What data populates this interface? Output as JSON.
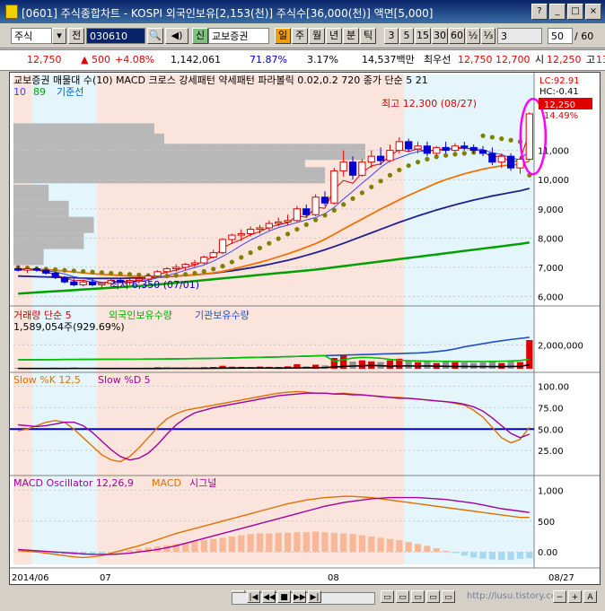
{
  "window": {
    "title": "[0601] 주식종합차트 - KOSPI 외국인보유[2,153(천)] 주식수[36,000(천)] 액면[5,000]",
    "buttons": [
      "?",
      "_",
      "□",
      "×"
    ]
  },
  "toolbar": {
    "market": "주식",
    "market_suffix": "전",
    "code": "030610",
    "name_tag": "신",
    "company": "교보증권",
    "period_buttons": [
      "일",
      "주",
      "월",
      "년",
      "분",
      "틱"
    ],
    "interval_buttons": [
      "3",
      "5",
      "15",
      "30",
      "60",
      "½",
      "⅓",
      "3"
    ],
    "count": "50",
    "count_suffix": "/ 60"
  },
  "quote": {
    "price": "12,750",
    "change": "500",
    "change_pct": "+4.08%",
    "volume": "1,142,061",
    "ratio1": "71.87%",
    "ratio2": "3.17%",
    "amount": "14,537백만",
    "best_label": "최우선",
    "best_ask": "12,750",
    "best_bid": "12,700",
    "open_label": "시",
    "open": "12,250",
    "high_label": "고",
    "high": "13"
  },
  "colors": {
    "up": "#e00000",
    "down": "#0000d0",
    "sar": "#808000",
    "ma5": "#e00000",
    "ma10": "#4040ff",
    "ma20": "#f07000",
    "ma60": "#202090",
    "ma120": "#00a000",
    "volume_profile": "#b8b8b8",
    "bg_salmon": "#fbe4dc",
    "bg_cyan": "#e4f6fc",
    "highlight": "#ff00ff"
  },
  "panels": {
    "price": {
      "legend_line1": "교보증권 매물대 수(10) MACD 크로스 강세패턴 약세패턴 파라볼릭 0.02,0.2 720 종가 단순 5 21",
      "legend_line2_a": "10",
      "legend_line2_b": "89",
      "legend_line2_c": "기준선",
      "axis_info": [
        "LC:92.91",
        "HC:-0.41"
      ],
      "current_price_tag": "12,250",
      "current_pct_tag": "14.49%",
      "high_annotation": "최고 12,300 (08/27)",
      "low_annotation": "최저 6,350 (07/01)"
    },
    "volume": {
      "legend": "거래량 단순 5",
      "legend_b": "외국인보유수량",
      "legend_c": "기관보유수량",
      "value_line": "1,589,054주(929.69%)"
    },
    "stochastic": {
      "legend_a": "Slow %K 12,5",
      "legend_b": "Slow %D 5"
    },
    "macd": {
      "legend_a": "MACD Oscillator 12,26,9",
      "legend_b": "MACD",
      "legend_c": "시그널"
    },
    "xaxis": {
      "labels": [
        "2014/06",
        "07",
        "08",
        "08/27"
      ]
    }
  },
  "chart_data": [
    {
      "type": "candlestick",
      "title": "교보증권",
      "ylim": [
        5800,
        12800
      ],
      "yticks": [
        6000,
        7000,
        8000,
        9000,
        10000,
        11000
      ],
      "candles": [
        {
          "o": 6950,
          "h": 7050,
          "l": 6850,
          "c": 6900
        },
        {
          "o": 6900,
          "h": 7000,
          "l": 6800,
          "c": 6950
        },
        {
          "o": 6950,
          "h": 7000,
          "l": 6850,
          "c": 6900
        },
        {
          "o": 6900,
          "h": 6950,
          "l": 6750,
          "c": 6800
        },
        {
          "o": 6800,
          "h": 6850,
          "l": 6600,
          "c": 6650
        },
        {
          "o": 6650,
          "h": 6700,
          "l": 6450,
          "c": 6500
        },
        {
          "o": 6500,
          "h": 6600,
          "l": 6350,
          "c": 6400
        },
        {
          "o": 6400,
          "h": 6550,
          "l": 6350,
          "c": 6500
        },
        {
          "o": 6500,
          "h": 6600,
          "l": 6350,
          "c": 6400
        },
        {
          "o": 6400,
          "h": 6500,
          "l": 6300,
          "c": 6450
        },
        {
          "o": 6450,
          "h": 6600,
          "l": 6350,
          "c": 6550
        },
        {
          "o": 6550,
          "h": 6650,
          "l": 6450,
          "c": 6500
        },
        {
          "o": 6500,
          "h": 6600,
          "l": 6400,
          "c": 6550
        },
        {
          "o": 6550,
          "h": 6700,
          "l": 6450,
          "c": 6600
        },
        {
          "o": 6600,
          "h": 6750,
          "l": 6500,
          "c": 6700
        },
        {
          "o": 6700,
          "h": 6900,
          "l": 6650,
          "c": 6850
        },
        {
          "o": 6850,
          "h": 7000,
          "l": 6750,
          "c": 6950
        },
        {
          "o": 6950,
          "h": 7100,
          "l": 6850,
          "c": 7000
        },
        {
          "o": 7000,
          "h": 7150,
          "l": 6900,
          "c": 7100
        },
        {
          "o": 7100,
          "h": 7250,
          "l": 7000,
          "c": 7150
        },
        {
          "o": 7150,
          "h": 7400,
          "l": 7100,
          "c": 7350
        },
        {
          "o": 7350,
          "h": 7600,
          "l": 7300,
          "c": 7500
        },
        {
          "o": 7500,
          "h": 8000,
          "l": 7450,
          "c": 7950
        },
        {
          "o": 7950,
          "h": 8150,
          "l": 7800,
          "c": 8100
        },
        {
          "o": 8100,
          "h": 8300,
          "l": 7900,
          "c": 8150
        },
        {
          "o": 8150,
          "h": 8400,
          "l": 8050,
          "c": 8300
        },
        {
          "o": 8300,
          "h": 8450,
          "l": 8150,
          "c": 8350
        },
        {
          "o": 8350,
          "h": 8600,
          "l": 8250,
          "c": 8500
        },
        {
          "o": 8500,
          "h": 8700,
          "l": 8400,
          "c": 8550
        },
        {
          "o": 8550,
          "h": 8800,
          "l": 8450,
          "c": 8600
        },
        {
          "o": 8600,
          "h": 9100,
          "l": 8550,
          "c": 9000
        },
        {
          "o": 9000,
          "h": 9150,
          "l": 8700,
          "c": 8800
        },
        {
          "o": 8800,
          "h": 9500,
          "l": 8750,
          "c": 9400
        },
        {
          "o": 9400,
          "h": 9600,
          "l": 9100,
          "c": 9200
        },
        {
          "o": 9200,
          "h": 10400,
          "l": 9150,
          "c": 10300
        },
        {
          "o": 10300,
          "h": 11000,
          "l": 10100,
          "c": 10600
        },
        {
          "o": 10600,
          "h": 10800,
          "l": 10000,
          "c": 10150
        },
        {
          "o": 10150,
          "h": 10700,
          "l": 10100,
          "c": 10600
        },
        {
          "o": 10600,
          "h": 11000,
          "l": 10400,
          "c": 10800
        },
        {
          "o": 10800,
          "h": 11100,
          "l": 10500,
          "c": 10650
        },
        {
          "o": 10650,
          "h": 11200,
          "l": 10600,
          "c": 11000
        },
        {
          "o": 11000,
          "h": 11450,
          "l": 10900,
          "c": 11300
        },
        {
          "o": 11300,
          "h": 11400,
          "l": 10950,
          "c": 11050
        },
        {
          "o": 11050,
          "h": 11300,
          "l": 10900,
          "c": 11150
        },
        {
          "o": 11150,
          "h": 11300,
          "l": 10800,
          "c": 10900
        },
        {
          "o": 10900,
          "h": 11150,
          "l": 10800,
          "c": 11100
        },
        {
          "o": 11100,
          "h": 11300,
          "l": 10900,
          "c": 11000
        },
        {
          "o": 11000,
          "h": 11250,
          "l": 10950,
          "c": 11150
        },
        {
          "o": 11150,
          "h": 11300,
          "l": 11000,
          "c": 11100
        },
        {
          "o": 11100,
          "h": 11200,
          "l": 10900,
          "c": 11000
        },
        {
          "o": 11000,
          "h": 11150,
          "l": 10800,
          "c": 10900
        },
        {
          "o": 10900,
          "h": 11100,
          "l": 10500,
          "c": 10600
        },
        {
          "o": 10600,
          "h": 10900,
          "l": 10400,
          "c": 10800
        },
        {
          "o": 10800,
          "h": 10900,
          "l": 10300,
          "c": 10400
        },
        {
          "o": 10400,
          "h": 10800,
          "l": 10200,
          "c": 10700
        },
        {
          "o": 10700,
          "h": 12300,
          "l": 10650,
          "c": 12250
        }
      ],
      "ma5": [
        6920,
        6910,
        6900,
        6890,
        6840,
        6770,
        6680,
        6620,
        6560,
        6480,
        6480,
        6480,
        6480,
        6510,
        6560,
        6640,
        6720,
        6800,
        6900,
        6990,
        7080,
        7210,
        7370,
        7550,
        7750,
        7930,
        8090,
        8240,
        8360,
        8440,
        8530,
        8620,
        8700,
        8840,
        9050,
        9340,
        9600,
        9880,
        10140,
        10420,
        10640,
        10750,
        10870,
        10960,
        10990,
        11000,
        11030,
        11060,
        11060,
        11060,
        11030,
        10920,
        10860,
        10740,
        10680,
        11000
      ],
      "ma20": [
        6950,
        6940,
        6930,
        6920,
        6900,
        6870,
        6840,
        6810,
        6780,
        6760,
        6740,
        6720,
        6700,
        6690,
        6680,
        6680,
        6690,
        6700,
        6720,
        6740,
        6770,
        6810,
        6860,
        6930,
        7010,
        7090,
        7170,
        7260,
        7360,
        7460,
        7570,
        7690,
        7810,
        7960,
        8130,
        8310,
        8480,
        8650,
        8820,
        8990,
        9150,
        9310,
        9460,
        9600,
        9740,
        9880,
        10000,
        10100,
        10200,
        10280,
        10360,
        10420,
        10470,
        10500,
        10530,
        10640
      ],
      "ma60": [
        6700,
        6690,
        6680,
        6670,
        6660,
        6650,
        6640,
        6630,
        6620,
        6620,
        6620,
        6620,
        6630,
        6640,
        6650,
        6660,
        6680,
        6700,
        6720,
        6740,
        6770,
        6800,
        6840,
        6880,
        6930,
        6980,
        7040,
        7100,
        7170,
        7240,
        7320,
        7410,
        7500,
        7600,
        7710,
        7820,
        7940,
        8060,
        8180,
        8300,
        8420,
        8540,
        8650,
        8760,
        8860,
        8960,
        9050,
        9140,
        9220,
        9300,
        9370,
        9440,
        9500,
        9560,
        9620,
        9700
      ],
      "ma120": [
        6100,
        6120,
        6140,
        6160,
        6180,
        6200,
        6220,
        6240,
        6260,
        6280,
        6300,
        6320,
        6340,
        6360,
        6380,
        6410,
        6440,
        6470,
        6500,
        6530,
        6560,
        6590,
        6620,
        6650,
        6680,
        6710,
        6740,
        6770,
        6800,
        6830,
        6860,
        6890,
        6920,
        6960,
        7000,
        7040,
        7080,
        7120,
        7160,
        7200,
        7240,
        7280,
        7320,
        7360,
        7400,
        7440,
        7480,
        7520,
        7560,
        7600,
        7640,
        7680,
        7720,
        7760,
        7800,
        7850
      ],
      "sar": [
        7000,
        6980,
        6960,
        6940,
        6920,
        6900,
        6880,
        6860,
        6840,
        6820,
        6800,
        6780,
        6760,
        6740,
        6720,
        6700,
        6700,
        6720,
        6760,
        6800,
        6860,
        6940,
        7040,
        7180,
        7340,
        7500,
        7660,
        7820,
        7980,
        8140,
        8300,
        8460,
        8620,
        8780,
        8950,
        9150,
        9350,
        9550,
        9750,
        9950,
        10150,
        10330,
        10480,
        10600,
        10700,
        10780,
        10830,
        10870,
        10900,
        10930,
        11500,
        11450,
        11400,
        11350,
        11300,
        10150
      ],
      "volume_profile": [
        {
          "price": 12300,
          "share": 0.0
        },
        {
          "price": 11650,
          "share": 0.28
        },
        {
          "price": 11300,
          "share": 0.3
        },
        {
          "price": 10950,
          "share": 0.7
        },
        {
          "price": 10600,
          "share": 0.58
        },
        {
          "price": 10150,
          "share": 0.62
        },
        {
          "price": 9550,
          "share": 0.07
        },
        {
          "price": 9000,
          "share": 0.11
        },
        {
          "price": 8450,
          "share": 0.16
        },
        {
          "price": 7900,
          "share": 0.14
        },
        {
          "price": 7350,
          "share": 0.06
        }
      ]
    },
    {
      "type": "bar",
      "title": "거래량",
      "ylim": [
        0,
        3000000
      ],
      "yticks": [
        2000000
      ],
      "volumes": [
        80000,
        60000,
        50000,
        70000,
        90000,
        80000,
        110000,
        60000,
        50000,
        70000,
        60000,
        50000,
        60000,
        70000,
        80000,
        120000,
        110000,
        90000,
        100000,
        90000,
        130000,
        150000,
        250000,
        170000,
        160000,
        140000,
        180000,
        160000,
        150000,
        200000,
        380000,
        200000,
        340000,
        280000,
        900000,
        1100000,
        600000,
        700000,
        620000,
        560000,
        700000,
        840000,
        640000,
        550000,
        600000,
        480000,
        600000,
        540000,
        520000,
        480000,
        520000,
        600000,
        480000,
        640000,
        560000,
        2400000
      ],
      "foreign": [
        70000,
        70000,
        72000,
        74000,
        76000,
        78000,
        80000,
        82000,
        84000,
        86000,
        88000,
        90000,
        92000,
        94000,
        96000,
        98000,
        100000,
        104000,
        108000,
        112000,
        118000,
        124000,
        130000,
        138000,
        146000,
        154000,
        162000,
        170000,
        178000,
        186000,
        196000,
        206000,
        216000,
        226000,
        236000,
        246000,
        256000,
        266000,
        276000,
        286000,
        296000,
        306000,
        316000,
        326000,
        346000,
        380000,
        420000,
        480000,
        560000,
        620000,
        680000,
        740000,
        790000,
        840000,
        880000,
        920000
      ],
      "institution": [
        0,
        0,
        0,
        0,
        0,
        0,
        0,
        0,
        0,
        0,
        0,
        0,
        0,
        0,
        0,
        0,
        0,
        0,
        0,
        0,
        0,
        0,
        0,
        0,
        0,
        0,
        0,
        0,
        0,
        0,
        0,
        0,
        0,
        0,
        180000,
        300000,
        410000,
        460000,
        440000,
        400000,
        320000,
        260000,
        230000,
        210000,
        200000,
        190000,
        190000,
        180000,
        170000,
        170000,
        170000,
        180000,
        190000,
        210000,
        240000,
        330000
      ]
    },
    {
      "type": "line",
      "title": "Slow Stochastic",
      "ylim": [
        0,
        110
      ],
      "yticks": [
        25,
        50,
        75,
        100
      ],
      "reference_line": 50,
      "slow_k": [
        48,
        50,
        54,
        58,
        60,
        58,
        50,
        40,
        30,
        20,
        14,
        12,
        18,
        28,
        40,
        52,
        62,
        68,
        72,
        74,
        76,
        78,
        80,
        82,
        84,
        86,
        88,
        90,
        92,
        93,
        94,
        93,
        92,
        92,
        91,
        92,
        91,
        90,
        89,
        88,
        87,
        87,
        86,
        85,
        84,
        83,
        82,
        80,
        78,
        72,
        64,
        52,
        40,
        34,
        38,
        52
      ],
      "slow_d": [
        55,
        54,
        53,
        54,
        56,
        58,
        58,
        54,
        46,
        36,
        26,
        18,
        14,
        16,
        22,
        32,
        44,
        55,
        63,
        69,
        72,
        75,
        77,
        79,
        81,
        83,
        85,
        87,
        89,
        90,
        91,
        92,
        92,
        92,
        91,
        91,
        90,
        90,
        89,
        88,
        87,
        86,
        86,
        85,
        84,
        83,
        82,
        81,
        79,
        76,
        71,
        63,
        54,
        45,
        40,
        44
      ]
    },
    {
      "type": "bar+line",
      "title": "MACD",
      "ylim": [
        -200,
        1150
      ],
      "yticks": [
        0,
        500,
        1000
      ],
      "oscillator": [
        0,
        0,
        -10,
        -20,
        -30,
        -40,
        -50,
        -50,
        -40,
        -30,
        -10,
        10,
        30,
        50,
        70,
        90,
        110,
        130,
        150,
        170,
        190,
        210,
        230,
        250,
        270,
        290,
        300,
        300,
        310,
        310,
        320,
        320,
        330,
        320,
        310,
        300,
        290,
        270,
        250,
        230,
        210,
        190,
        160,
        130,
        100,
        60,
        20,
        -20,
        -60,
        -90,
        -110,
        -120,
        -130,
        -130,
        -110,
        -100
      ],
      "macd": [
        20,
        10,
        0,
        -20,
        -40,
        -60,
        -80,
        -90,
        -80,
        -60,
        -20,
        20,
        60,
        100,
        150,
        200,
        250,
        300,
        340,
        380,
        420,
        460,
        500,
        540,
        580,
        620,
        660,
        700,
        740,
        780,
        810,
        840,
        860,
        880,
        890,
        900,
        900,
        890,
        880,
        860,
        840,
        820,
        800,
        780,
        760,
        740,
        720,
        700,
        680,
        660,
        640,
        620,
        600,
        580,
        560,
        560
      ],
      "signal": [
        40,
        30,
        20,
        10,
        0,
        -10,
        -20,
        -30,
        -40,
        -40,
        -40,
        -30,
        -20,
        0,
        20,
        40,
        70,
        100,
        140,
        180,
        220,
        260,
        300,
        340,
        380,
        420,
        460,
        500,
        540,
        580,
        620,
        660,
        700,
        740,
        770,
        800,
        820,
        840,
        860,
        870,
        880,
        880,
        880,
        880,
        870,
        860,
        850,
        830,
        810,
        790,
        760,
        730,
        700,
        680,
        660,
        640
      ]
    }
  ]
}
